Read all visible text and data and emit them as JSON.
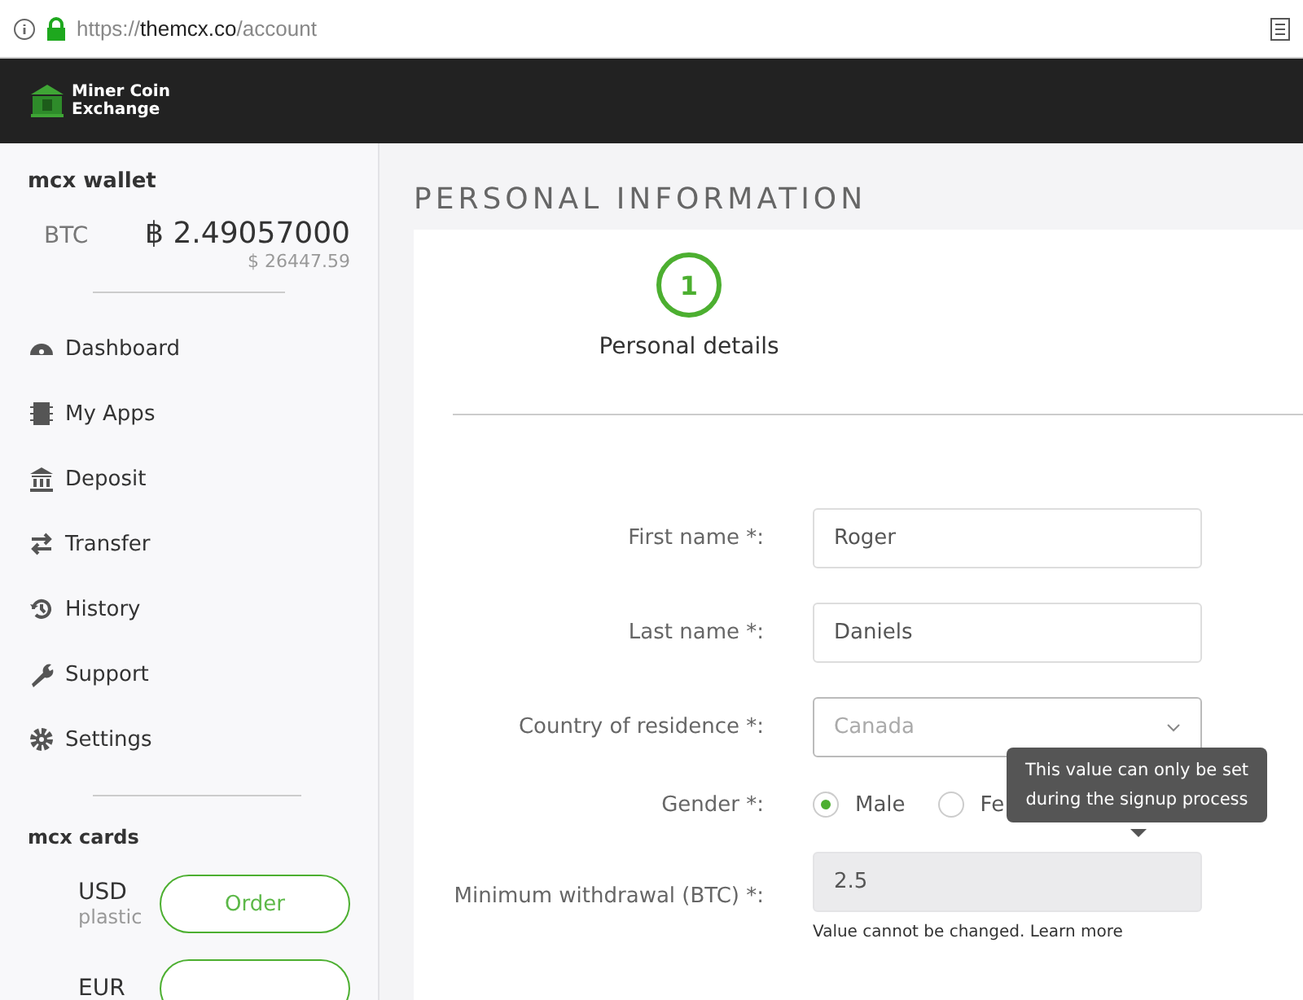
{
  "browser": {
    "url_host": "themcx.co",
    "url_scheme": "https://",
    "url_path": "/account"
  },
  "header": {
    "logo_text": [
      "Miner Coin",
      "Exchange"
    ]
  },
  "sidebar": {
    "wallet_title": "mcx wallet",
    "currency": "BTC",
    "balance": "฿ 2.49057000",
    "balance_usd": "$ 26447.59",
    "items": [
      {
        "label": "Dashboard"
      },
      {
        "label": "My Apps"
      },
      {
        "label": "Deposit"
      },
      {
        "label": "Transfer"
      },
      {
        "label": "History"
      },
      {
        "label": "Support"
      },
      {
        "label": "Settings"
      }
    ],
    "cards_title": "mcx cards",
    "cards": [
      {
        "currency": "USD",
        "type": "plastic",
        "button": "Order"
      },
      {
        "currency": "EUR"
      }
    ]
  },
  "page_title": "PERSONAL INFORMATION",
  "step": {
    "number": "1",
    "label": "Personal details"
  },
  "form": [
    {
      "kind": "text",
      "label": "First name *:",
      "value": "Roger"
    },
    {
      "kind": "text",
      "label": "Last name *:",
      "value": "Daniels"
    },
    {
      "kind": "select",
      "label": "Country of residence *:",
      "value": "Canada"
    },
    {
      "kind": "radio",
      "label": "Gender *:",
      "options": [
        {
          "label": "Male",
          "selected": true
        },
        {
          "label": "Fe",
          "selected": false
        }
      ]
    },
    {
      "kind": "text",
      "label": "Minimum withdrawal (BTC) *:",
      "value": "2.5",
      "disabled": true,
      "help": "Value cannot be changed.",
      "help_link": "Learn more"
    }
  ],
  "tooltip": "This value can only be set during the signup process"
}
